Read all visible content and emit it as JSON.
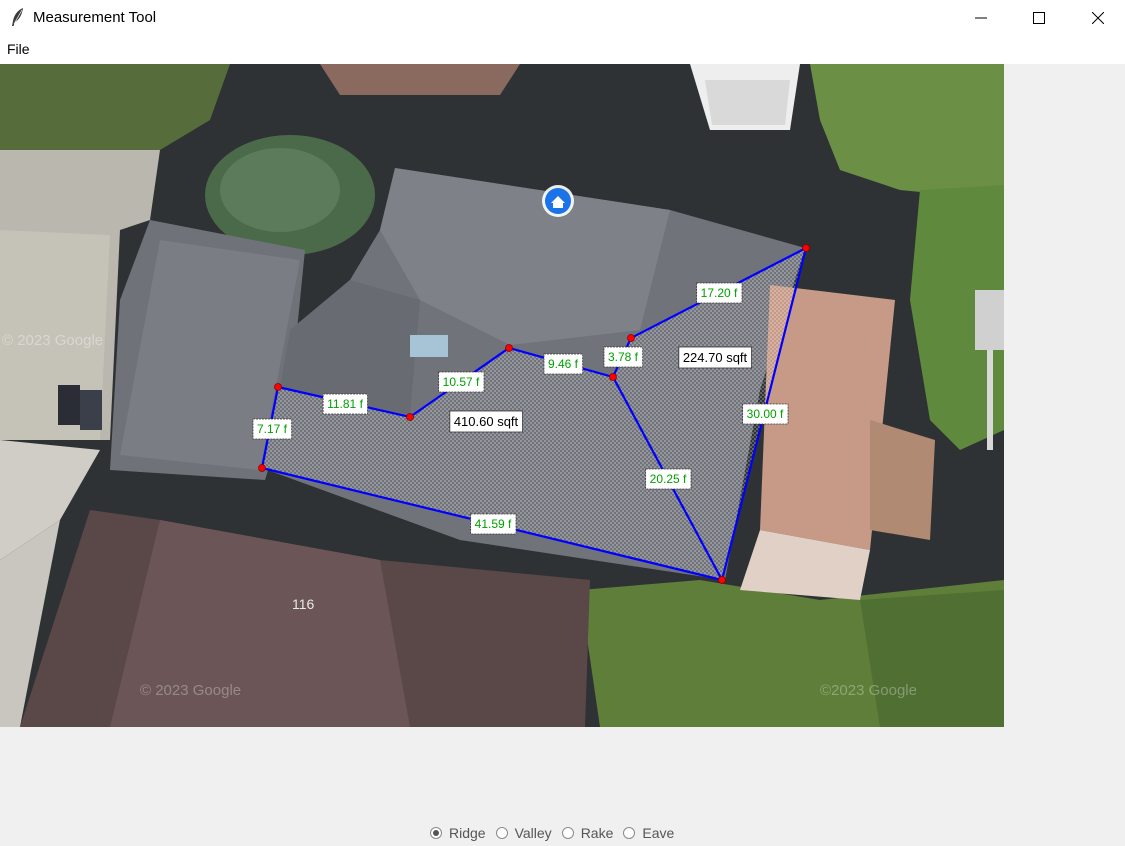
{
  "window": {
    "title": "Measurement Tool",
    "controls": [
      "minimize",
      "maximize",
      "close"
    ]
  },
  "menu": {
    "file_label": "File"
  },
  "map": {
    "house_number": "116",
    "watermark_1": "© 2023 Google",
    "watermark_2": "© 2023 Google",
    "watermark_3": "©2023 Google"
  },
  "measurements": {
    "edges": [
      "7.17 f",
      "11.81 f",
      "10.57 f",
      "9.46 f",
      "3.78 f",
      "17.20 f",
      "30.00 f",
      "20.25 f",
      "41.59 f"
    ],
    "areas": [
      "410.60 sqft",
      "224.70 sqft"
    ],
    "colors": {
      "line": "#0000ff",
      "vertex": "#ff0000",
      "edge_label_text": "#00a000",
      "area_label_text": "#000000"
    }
  },
  "line_types": {
    "options": [
      "Ridge",
      "Valley",
      "Rake",
      "Eave"
    ],
    "selected": "Ridge"
  }
}
